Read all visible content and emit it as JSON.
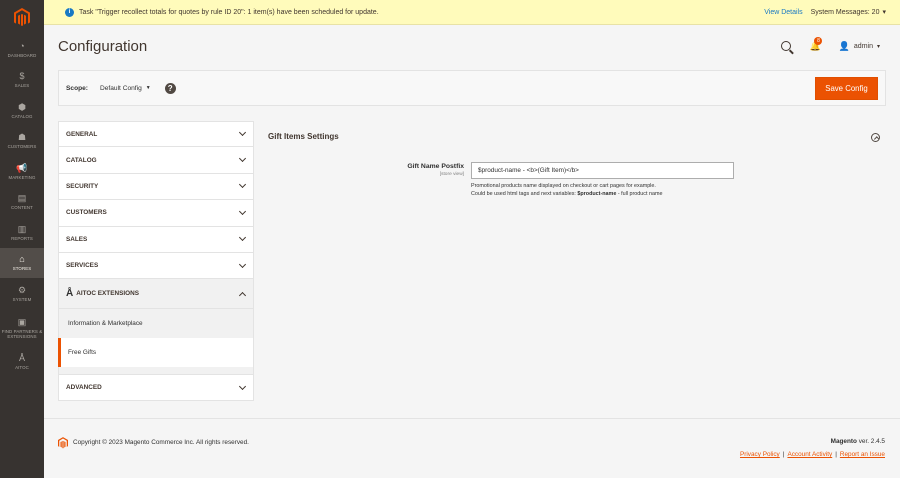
{
  "colors": {
    "nav_bg": "#373330",
    "accent": "#eb5202",
    "link": "#1979c3",
    "notice_bg": "#fffbbb"
  },
  "nav": {
    "logo_icon": "magento-logo-icon",
    "items": [
      {
        "label": "Dashboard",
        "icon": "dashboard-icon",
        "glyph": "◔"
      },
      {
        "label": "Sales",
        "icon": "dollar-icon",
        "glyph": "$"
      },
      {
        "label": "Catalog",
        "icon": "cube-icon",
        "glyph": "⬢"
      },
      {
        "label": "Customers",
        "icon": "person-icon",
        "glyph": "☗"
      },
      {
        "label": "Marketing",
        "icon": "megaphone-icon",
        "glyph": "📢"
      },
      {
        "label": "Content",
        "icon": "content-icon",
        "glyph": "▤"
      },
      {
        "label": "Reports",
        "icon": "bar-chart-icon",
        "glyph": "▥"
      },
      {
        "label": "Stores",
        "icon": "store-icon",
        "glyph": "⌂"
      },
      {
        "label": "System",
        "icon": "gear-icon",
        "glyph": "⚙"
      },
      {
        "label": "Find Partners & Extensions",
        "icon": "box-icon",
        "glyph": "▣"
      },
      {
        "label": "Aitoc",
        "icon": "aitoc-icon",
        "glyph": "Å"
      }
    ],
    "active_label": "Stores"
  },
  "notice": {
    "message": "Task \"Trigger recollect totals for quotes by rule ID 20\": 1 item(s) have been scheduled for update.",
    "view_details": "View Details",
    "system_messages": "System Messages: 20"
  },
  "header": {
    "title": "Configuration",
    "notification_count": "8",
    "user": "admin"
  },
  "scope": {
    "label": "Scope:",
    "value": "Default Config",
    "help": "?",
    "save_label": "Save Config"
  },
  "tabs": {
    "general": "GENERAL",
    "catalog": "CATALOG",
    "security": "SECURITY",
    "customers": "CUSTOMERS",
    "sales": "SALES",
    "services": "SERVICES",
    "aitoc": "AITOC EXTENSIONS",
    "aitoc_mark": "Å",
    "sub_info": "Information & Marketplace",
    "sub_free_gifts": "Free Gifts",
    "advanced": "ADVANCED"
  },
  "section": {
    "title": "Gift Items Settings",
    "field_label": "Gift Name Postfix",
    "field_scope": "[store view]",
    "field_value": "$product-name - <b>(Gift Item)</b>",
    "note_line1": "Promotional products name displayed on checkout or cart pages for example.",
    "note_line2_prefix": "Could be used html tags and next variables: ",
    "note_line2_var": "$product-name",
    "note_line2_suffix": " - full product name"
  },
  "footer": {
    "copyright": "Copyright © 2023 Magento Commerce Inc. All rights reserved.",
    "brand": "Magento",
    "version": " ver. 2.4.5",
    "privacy": "Privacy Policy",
    "activity": "Account Activity",
    "report": "Report an Issue",
    "separator": "|"
  }
}
